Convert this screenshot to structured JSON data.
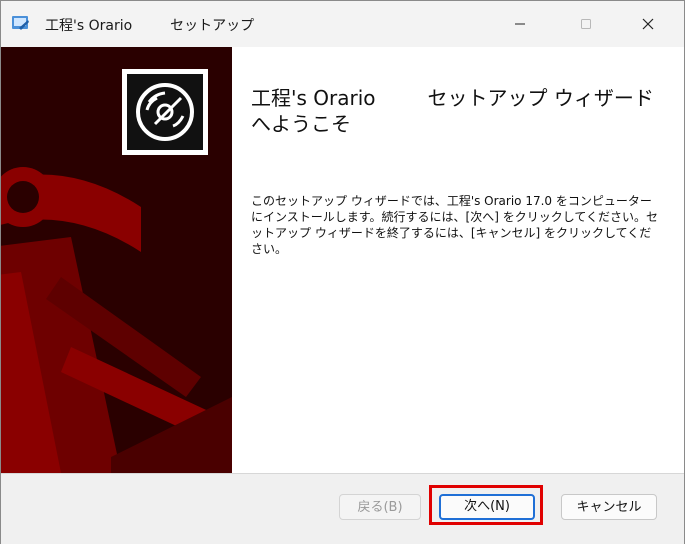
{
  "window": {
    "title_app": "工程's Orario",
    "title_sub": "セットアップ",
    "min_icon": "minimize-icon",
    "max_icon": "maximize-icon",
    "close_icon": "close-icon"
  },
  "wizard": {
    "heading_part1": "工程's Orario",
    "heading_part2": "セットアップ ウィザードへようこそ",
    "body": "このセットアップ ウィザードでは、工程's Orario 17.0 をコンピューターにインストールします。続行するには、[次へ] をクリックしてください。セットアップ ウィザードを終了するには、[キャンセル] をクリックしてください。"
  },
  "buttons": {
    "back": "戻る(B)",
    "next": "次へ(N)",
    "cancel": "キャンセル"
  },
  "colors": {
    "banner_dark": "#2a0000",
    "banner_red": "#8a0000",
    "highlight": "#e00000",
    "focus": "#1f6fd6"
  }
}
